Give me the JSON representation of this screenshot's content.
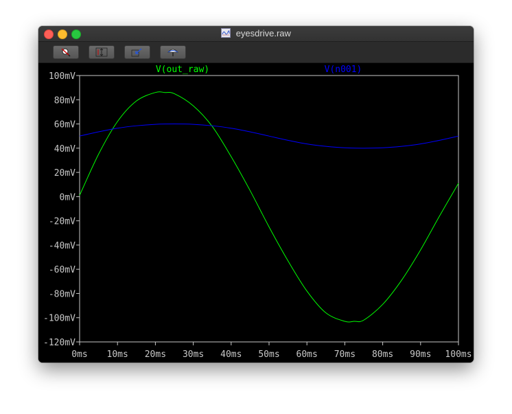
{
  "window": {
    "title": "eyesdrive.raw",
    "controls": [
      "close",
      "minimize",
      "maximize"
    ]
  },
  "toolbar": {
    "buttons": [
      {
        "icon": "zoom-cancel-icon",
        "action": "Zoom cancel"
      },
      {
        "icon": "autorange-y-icon",
        "action": "Autorange Y axis"
      },
      {
        "icon": "zoom-back-icon",
        "action": "Zoom back"
      },
      {
        "icon": "pick-trace-icon",
        "action": "Pick trace"
      }
    ]
  },
  "colors": {
    "background": "#000000",
    "axis": "#c8c8c8",
    "v_out_raw": "#00ff00",
    "v_n001": "#0000ff"
  },
  "chart_data": {
    "type": "line",
    "x_ticks": [
      "0ms",
      "10ms",
      "20ms",
      "30ms",
      "40ms",
      "50ms",
      "60ms",
      "70ms",
      "80ms",
      "90ms",
      "100ms"
    ],
    "y_ticks": [
      "100mV",
      "80mV",
      "60mV",
      "40mV",
      "20mV",
      "0mV",
      "-20mV",
      "-40mV",
      "-60mV",
      "-80mV",
      "-100mV",
      "-120mV"
    ],
    "xlim": [
      0,
      100
    ],
    "ylim": [
      -120,
      100
    ],
    "x_unit": "ms",
    "y_unit": "mV",
    "grid": false,
    "series": [
      {
        "name": "V(out_raw)",
        "color": "#00ff00",
        "x": [
          0,
          5,
          10,
          15,
          20,
          22.5,
          25,
          30,
          35,
          40,
          45,
          50,
          55,
          60,
          65,
          70,
          72.5,
          75,
          80,
          85,
          90,
          95,
          100
        ],
        "y": [
          1,
          35,
          62,
          79,
          86,
          86,
          85,
          75,
          58,
          33,
          5,
          -25,
          -53,
          -78,
          -96,
          -103,
          -103,
          -102,
          -89,
          -69,
          -44,
          -16,
          11
        ]
      },
      {
        "name": "V(n001)",
        "color": "#0000ff",
        "x": [
          0,
          5,
          10,
          15,
          20,
          25,
          30,
          35,
          40,
          45,
          50,
          55,
          60,
          65,
          70,
          75,
          80,
          85,
          90,
          95,
          100
        ],
        "y": [
          50,
          53.5,
          56.5,
          58.5,
          59.7,
          60,
          59.7,
          58.5,
          56.5,
          53.5,
          50,
          46.5,
          43.5,
          41.5,
          40.3,
          40,
          40.3,
          41.5,
          43.5,
          46.5,
          50
        ]
      }
    ]
  }
}
